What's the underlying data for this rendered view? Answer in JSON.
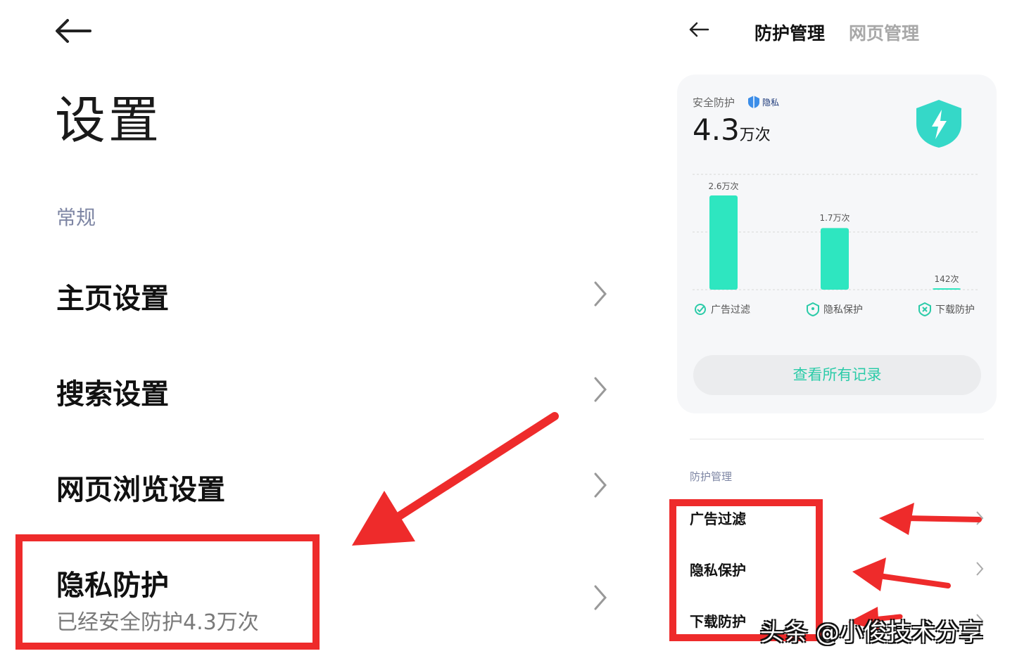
{
  "left": {
    "title": "设置",
    "section": "常规",
    "items": [
      {
        "label": "主页设置"
      },
      {
        "label": "搜索设置"
      },
      {
        "label": "网页浏览设置"
      },
      {
        "label": "隐私防护",
        "sub": "已经安全防护4.3万次"
      }
    ]
  },
  "right": {
    "tabs": [
      {
        "label": "防护管理",
        "active": true
      },
      {
        "label": "网页管理",
        "active": false
      }
    ],
    "card": {
      "label": "安全防护",
      "badge": "隐私",
      "total_value": "4.3",
      "total_unit": "万次",
      "button": "查看所有记录"
    },
    "section": "防护管理",
    "items": [
      "广告过滤",
      "隐私保护",
      "下载防护"
    ]
  },
  "chart_data": {
    "type": "bar",
    "categories": [
      "广告过滤",
      "隐私保护",
      "下载防护"
    ],
    "values": [
      26000,
      17000,
      142
    ],
    "value_labels": [
      "2.6万次",
      "1.7万次",
      "142次"
    ],
    "ylim": [
      0,
      26000
    ],
    "grid": true
  },
  "watermark": "头条 @小俊技术分享",
  "colors": {
    "accent": "#2ee6c0",
    "highlight": "#ee2b2b",
    "button_text": "#2bcba8"
  }
}
